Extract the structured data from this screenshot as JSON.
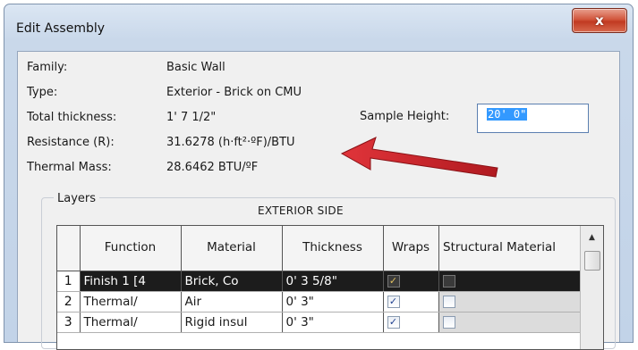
{
  "window": {
    "title": "Edit Assembly",
    "close_label": "x"
  },
  "properties": {
    "family_label": "Family:",
    "family_value": "Basic Wall",
    "type_label": "Type:",
    "type_value": "Exterior - Brick on CMU",
    "thickness_label": "Total thickness:",
    "thickness_value": "1' 7 1/2\"",
    "resistance_label": "Resistance (R):",
    "resistance_value": "31.6278 (h·ft²·ºF)/BTU",
    "thermal_label": "Thermal Mass:",
    "thermal_value": "28.6462 BTU/ºF",
    "sample_height_label": "Sample Height:",
    "sample_height_value": "20' 0\""
  },
  "layers": {
    "legend": "Layers",
    "side_label": "EXTERIOR SIDE",
    "columns": [
      "Function",
      "Material",
      "Thickness",
      "Wraps",
      "Structural Material"
    ],
    "rows": [
      {
        "num": "1",
        "function": "Finish 1 [4",
        "material": "Brick, Co",
        "thickness": "0' 3 5/8\"",
        "wraps": true,
        "structural": false
      },
      {
        "num": "2",
        "function": "Thermal/",
        "material": "Air",
        "thickness": "0' 3\"",
        "wraps": true,
        "structural": false
      },
      {
        "num": "3",
        "function": "Thermal/",
        "material": "Rigid insul",
        "thickness": "0' 3\"",
        "wraps": true,
        "structural": false
      }
    ]
  },
  "colors": {
    "annotation_arrow": "#c8242a",
    "selected_row": "#1c1c1c",
    "selection_highlight": "#3399ff"
  },
  "icons": {
    "close": "close-icon",
    "scroll_up": "scroll-up-arrow-icon",
    "annotation": "red-arrow-icon",
    "check": "checkmark-icon"
  }
}
